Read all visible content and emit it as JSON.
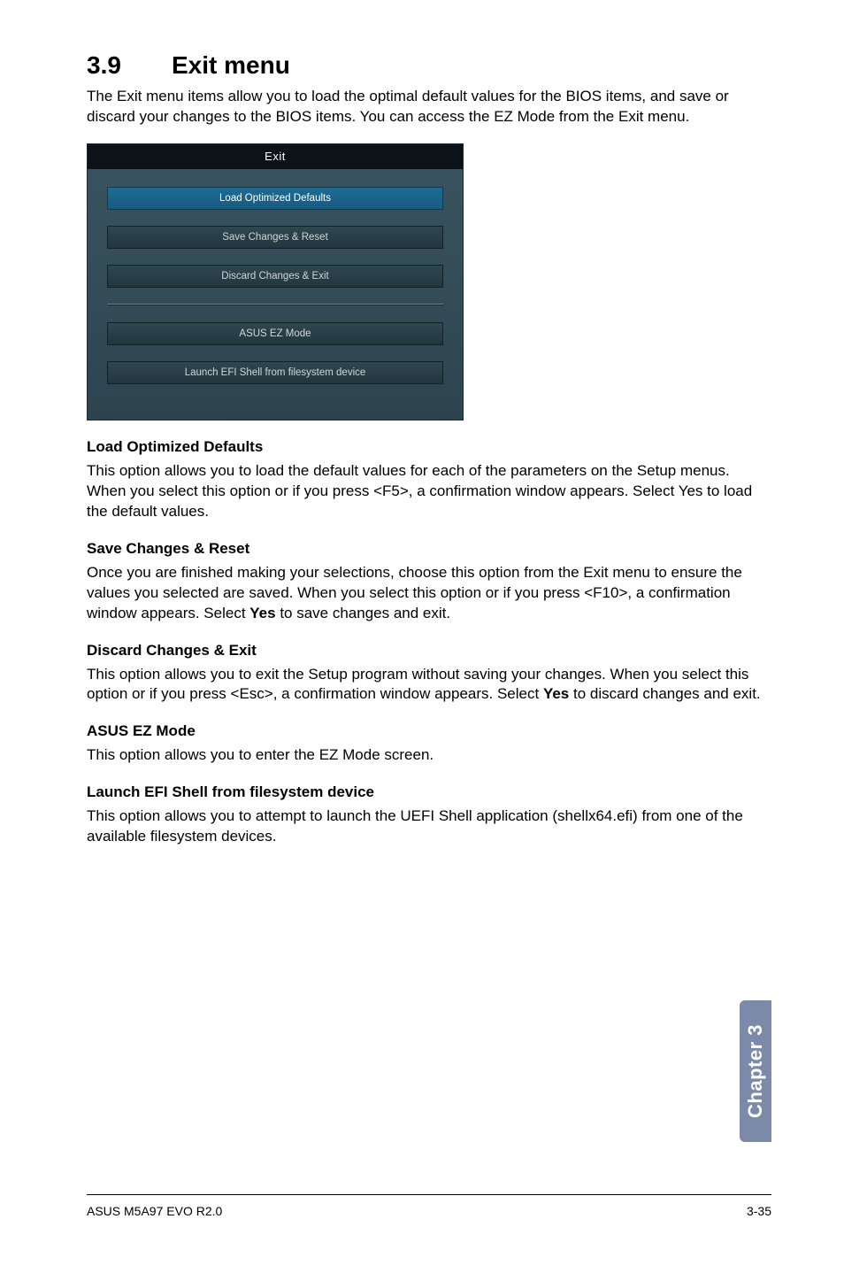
{
  "section": {
    "number": "3.9",
    "title": "Exit menu"
  },
  "intro": "The Exit menu items allow you to load the optimal default values for the BIOS items, and save or discard your changes to the BIOS items. You can access the EZ Mode from the Exit menu.",
  "bios": {
    "header": "Exit",
    "items_top": [
      {
        "label": "Load Optimized Defaults",
        "selected": true
      },
      {
        "label": "Save Changes & Reset",
        "selected": false
      },
      {
        "label": "Discard Changes & Exit",
        "selected": false
      }
    ],
    "items_bottom": [
      {
        "label": "ASUS EZ Mode",
        "selected": false
      },
      {
        "label": "Launch EFI Shell from filesystem device",
        "selected": false
      }
    ]
  },
  "subs": {
    "load_title": "Load Optimized Defaults",
    "load_body": "This option allows you to load the default values for each of the parameters on the Setup menus. When you select this option or if you press <F5>, a confirmation window appears. Select Yes to load the default values.",
    "save_title": "Save Changes & Reset",
    "save_body_1": "Once you are finished making your selections, choose this option from the Exit menu to ensure the values you selected are saved. When you select this option or if you press <F10>, a confirmation window appears. Select ",
    "save_body_bold": "Yes",
    "save_body_2": " to save changes and exit.",
    "discard_title": "Discard Changes & Exit",
    "discard_body_1": "This option allows you to exit the Setup program without saving your changes. When you select this option or if you press <Esc>, a confirmation window appears. Select ",
    "discard_body_bold": "Yes",
    "discard_body_2": " to discard changes and exit.",
    "ez_title": "ASUS EZ Mode",
    "ez_body": "This option allows you to enter the EZ Mode screen.",
    "efi_title": "Launch EFI Shell from filesystem device",
    "efi_body": "This option allows you to attempt to launch the UEFI Shell application (shellx64.efi) from one of the available filesystem devices."
  },
  "chapter_tab": "Chapter 3",
  "footer": {
    "left": "ASUS M5A97 EVO R2.0",
    "right": "3-35"
  }
}
